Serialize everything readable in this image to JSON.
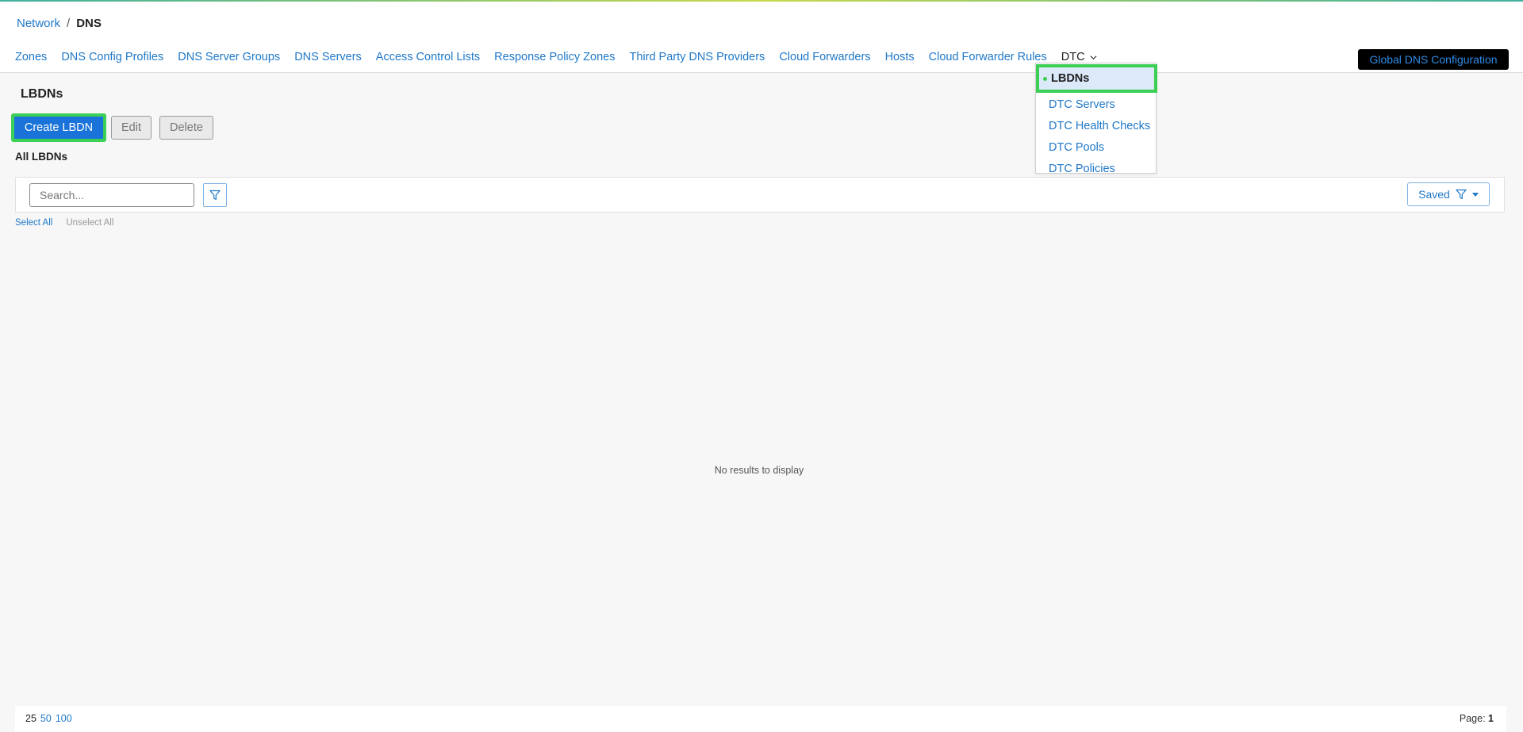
{
  "breadcrumb": {
    "parent": "Network",
    "separator": "/",
    "current": "DNS"
  },
  "nav": {
    "tabs": [
      {
        "label": "Zones"
      },
      {
        "label": "DNS Config Profiles"
      },
      {
        "label": "DNS Server Groups"
      },
      {
        "label": "DNS Servers"
      },
      {
        "label": "Access Control Lists"
      },
      {
        "label": "Response Policy Zones"
      },
      {
        "label": "Third Party DNS Providers"
      },
      {
        "label": "Cloud Forwarders"
      },
      {
        "label": "Hosts"
      },
      {
        "label": "Cloud Forwarder Rules"
      }
    ],
    "active_tab": "DTC",
    "global_button": "Global DNS Configuration"
  },
  "dropdown": {
    "items": [
      "LBDNs",
      "DTC Servers",
      "DTC Health Checks",
      "DTC Pools",
      "DTC Policies"
    ],
    "selected": "LBDNs"
  },
  "page": {
    "title": "LBDNs",
    "create_label": "Create LBDN",
    "edit_label": "Edit",
    "delete_label": "Delete",
    "subtitle": "All LBDNs"
  },
  "toolbar": {
    "search_placeholder": "Search...",
    "search_value": "",
    "saved_label": "Saved"
  },
  "selection": {
    "select_all": "Select All",
    "unselect_all": "Unselect All"
  },
  "empty_message": "No results to display",
  "footer": {
    "page_sizes": [
      "25",
      "50",
      "100"
    ],
    "current_page_size": "25",
    "page_label": "Page:",
    "page_number": "1"
  },
  "colors": {
    "link": "#1f78c8",
    "primary": "#1a73d9",
    "highlight": "#3ccf55",
    "global_button_bg": "#000000"
  },
  "icons": {
    "filter": "filter-icon",
    "chevron": "chevron-down-icon",
    "caret": "caret-down-icon"
  }
}
